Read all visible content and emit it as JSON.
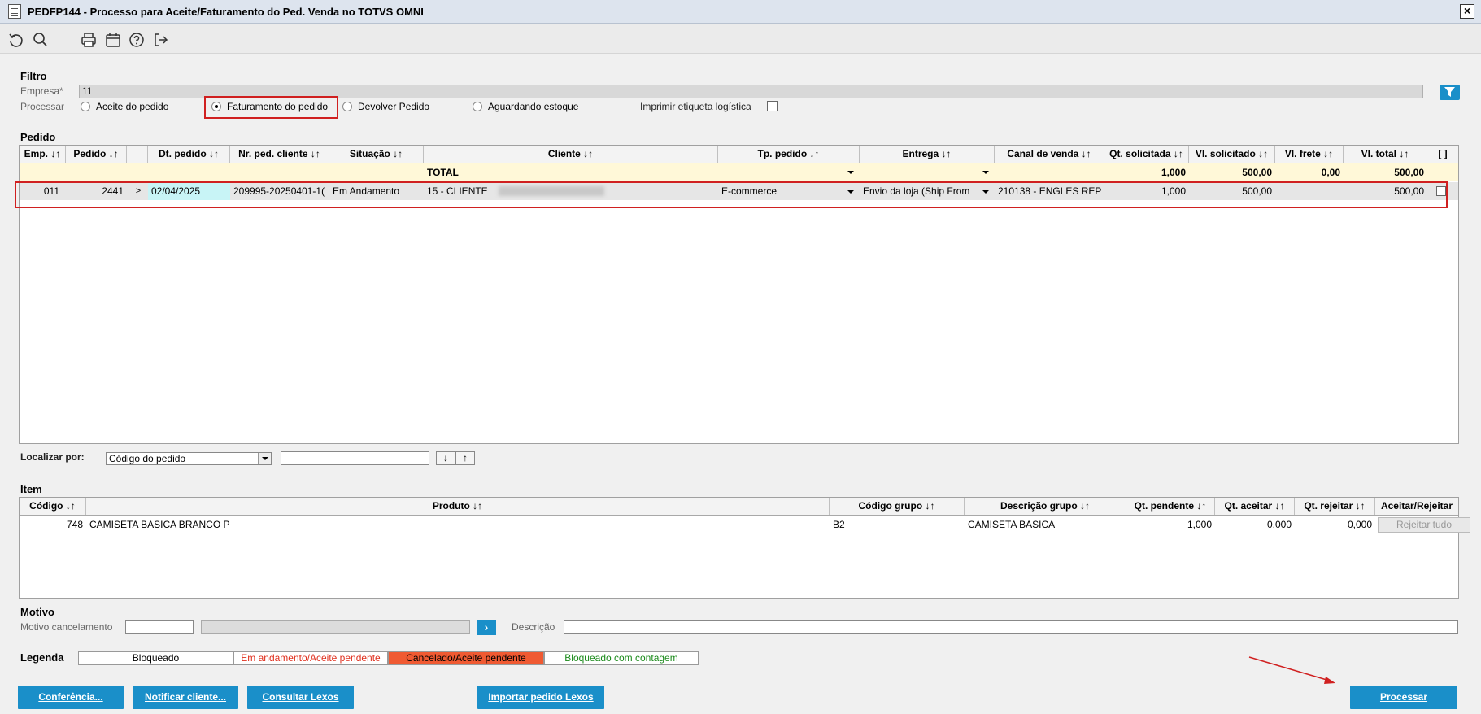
{
  "window": {
    "title": "PEDFP144 - Processo para Aceite/Faturamento do Ped. Venda no TOTVS OMNI",
    "close_label": "×"
  },
  "toolbar": {
    "icons": [
      "undo-icon",
      "search-icon",
      "print-icon",
      "calendar-icon",
      "help-icon",
      "exit-icon"
    ]
  },
  "filtro": {
    "section": "Filtro",
    "empresa_label": "Empresa*",
    "empresa_value": "11",
    "processar_label": "Processar",
    "options": [
      "Aceite do pedido",
      "Faturamento do pedido",
      "Devolver Pedido",
      "Aguardando estoque"
    ],
    "selected_option": "Faturamento do pedido",
    "imprimir_label": "Imprimir etiqueta logística"
  },
  "pedido": {
    "section": "Pedido",
    "columns": [
      "Emp. ↓↑",
      "Pedido ↓↑",
      "",
      "Dt. pedido ↓↑",
      "Nr. ped. cliente ↓↑",
      "Situação ↓↑",
      "Cliente ↓↑",
      "Tp. pedido ↓↑",
      "Entrega ↓↑",
      "Canal de venda ↓↑",
      "Qt. solicitada ↓↑",
      "Vl. solicitado ↓↑",
      "Vl. frete ↓↑",
      "Vl. total ↓↑",
      "[ ]"
    ],
    "total_row": {
      "label": "TOTAL",
      "qt_solicitada": "1,000",
      "vl_solicitado": "500,00",
      "vl_frete": "0,00",
      "vl_total": "500,00"
    },
    "rows": [
      {
        "emp": "011",
        "pedido": "2441",
        "expand": ">",
        "dt_pedido": "02/04/2025",
        "nr_ped_cliente": "209995-20250401-1(",
        "situacao": "Em Andamento",
        "cliente": "15 - CLIENTE",
        "tp_pedido": "E-commerce",
        "entrega": "Envio da loja (Ship From",
        "canal": "210138 - ENGLES REP",
        "qt_solicitada": "1,000",
        "vl_solicitado": "500,00",
        "vl_frete": "",
        "vl_total": "500,00"
      }
    ]
  },
  "localizar": {
    "label": "Localizar por:",
    "selected": "Código do pedido",
    "down": "↓",
    "up": "↑"
  },
  "item": {
    "section": "Item",
    "columns": [
      "Código ↓↑",
      "Produto ↓↑",
      "Código grupo ↓↑",
      "Descrição grupo ↓↑",
      "Qt. pendente ↓↑",
      "Qt. aceitar ↓↑",
      "Qt. rejeitar ↓↑",
      "Aceitar/Rejeitar"
    ],
    "rows": [
      {
        "codigo": "748",
        "produto": "CAMISETA BASICA BRANCO P",
        "codigo_grupo": "B2",
        "descricao_grupo": "CAMISETA BASICA",
        "qt_pendente": "1,000",
        "qt_aceitar": "0,000",
        "qt_rejeitar": "0,000",
        "action": "Rejeitar tudo"
      }
    ]
  },
  "motivo": {
    "section": "Motivo",
    "cancel_label": "Motivo cancelamento",
    "go": "›",
    "descricao_label": "Descrição"
  },
  "legenda": {
    "label": "Legenda",
    "items": [
      {
        "text": "Bloqueado",
        "color": "#000000",
        "bg": "#ffffff"
      },
      {
        "text": "Em andamento/Aceite pendente",
        "color": "#e0301e",
        "bg": "#ffffff"
      },
      {
        "text": "Cancelado/Aceite pendente",
        "color": "#000000",
        "bg": "#f05a32"
      },
      {
        "text": "Bloqueado com contagem",
        "color": "#1a8a1a",
        "bg": "#ffffff"
      }
    ]
  },
  "buttons": {
    "conferencia": "Conferência...",
    "notificar": "Notificar cliente...",
    "consultar": "Consultar Lexos",
    "importar": "Importar pedido Lexos",
    "processar": "Processar"
  },
  "colors": {
    "accent": "#1a8fc9",
    "total_row_bg": "#fff8d8",
    "highlight": "#d02020",
    "date_cell_bg": "#c8f4f6"
  }
}
